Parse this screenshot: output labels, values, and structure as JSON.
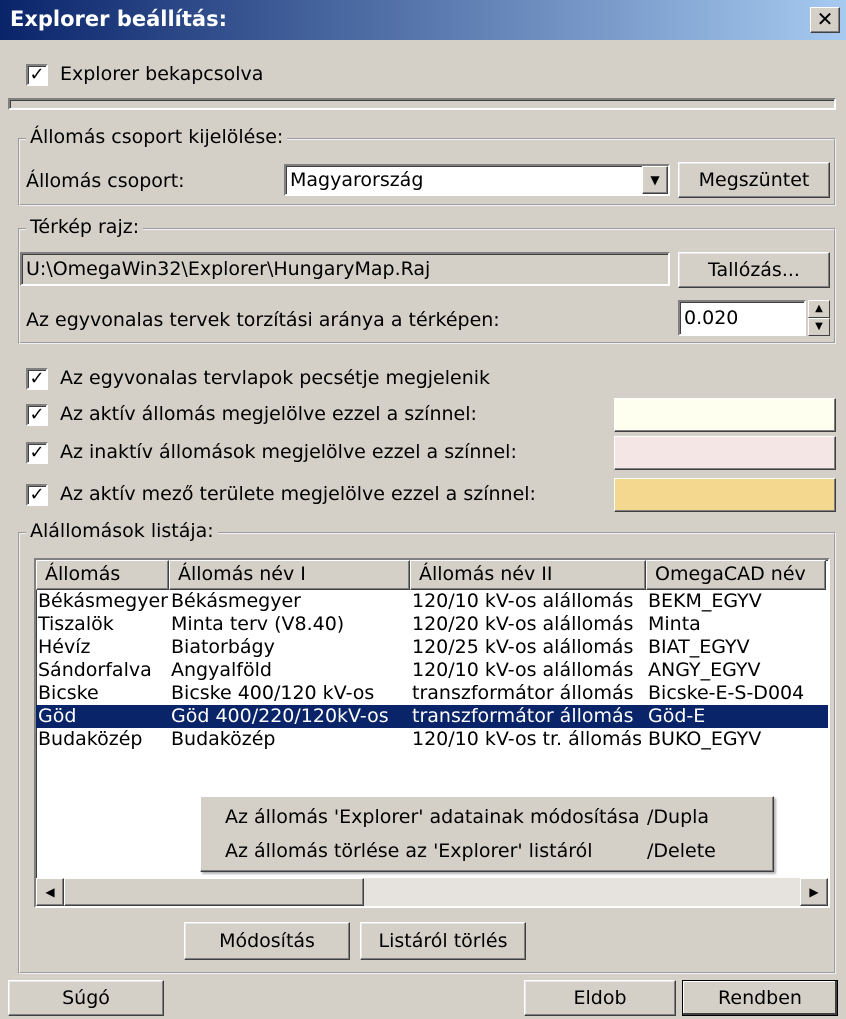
{
  "window": {
    "title": "Explorer beállítás:",
    "close_glyph": "✕"
  },
  "explorer_enabled": {
    "label": "Explorer bekapcsolva",
    "checked": true
  },
  "station_group": {
    "legend": "Állomás csoport kijelölése:",
    "label": "Állomás csoport:",
    "value": "Magyarország",
    "clear_button": "Megszüntet"
  },
  "map": {
    "legend": "Térkép rajz:",
    "path": "U:\\OmegaWin32\\Explorer\\HungaryMap.Raj",
    "browse_button": "Tallózás...",
    "distortion_label": "Az egyvonalas tervek torzítási aránya a térképen:",
    "distortion_value": "0.020"
  },
  "options": [
    {
      "label": "Az egyvonalas tervlapok pecsétje megjelenik",
      "checked": true
    },
    {
      "label": "Az aktív állomás megjelölve ezzel a színnel:",
      "checked": true,
      "color": "#fffff0"
    },
    {
      "label": "Az inaktív állomások megjelölve ezzel a színnel:",
      "checked": true,
      "color": "#f5e6e6"
    },
    {
      "label": "Az aktív mező területe megjelölve ezzel a színnel:",
      "checked": true,
      "color": "#f5d890"
    }
  ],
  "substations": {
    "legend": "Alállomások listája:",
    "columns": [
      "Állomás",
      "Állomás név I",
      "Állomás név II",
      "OmegaCAD név"
    ],
    "rows": [
      [
        "Békásmegyer",
        "Békásmegyer",
        "120/10 kV-os alállomás",
        "BEKM_EGYV"
      ],
      [
        "Tiszalök",
        "Minta terv (V8.40)",
        "120/20 kV-os alállomás",
        "Minta"
      ],
      [
        "Hévíz",
        "Biatorbágy",
        "120/25 kV-os alállomás",
        "BIAT_EGYV"
      ],
      [
        "Sándorfalva",
        "Angyalföld",
        "120/10 kV-os alállomás",
        "ANGY_EGYV"
      ],
      [
        "Bicske",
        "Bicske 400/120 kV-os",
        "transzformátor állomás",
        "Bicske-E-S-D004"
      ],
      [
        "Göd",
        "Göd 400/220/120kV-os",
        "transzformátor állomás",
        "Göd-E"
      ],
      [
        "Budaközép",
        "Budaközép",
        "120/10 kV-os tr. állomás",
        "BUKO_EGYV"
      ]
    ],
    "selected_row": 5,
    "context_menu": [
      {
        "label": "Az állomás 'Explorer' adatainak módosítása",
        "shortcut": "/Dupla"
      },
      {
        "label": "Az állomás törlése az 'Explorer' listáról",
        "shortcut": "/Delete"
      }
    ],
    "modify_button": "Módosítás",
    "delete_button": "Listáról törlés"
  },
  "footer": {
    "help_button": "Súgó",
    "cancel_button": "Eldob",
    "ok_button": "Rendben"
  }
}
